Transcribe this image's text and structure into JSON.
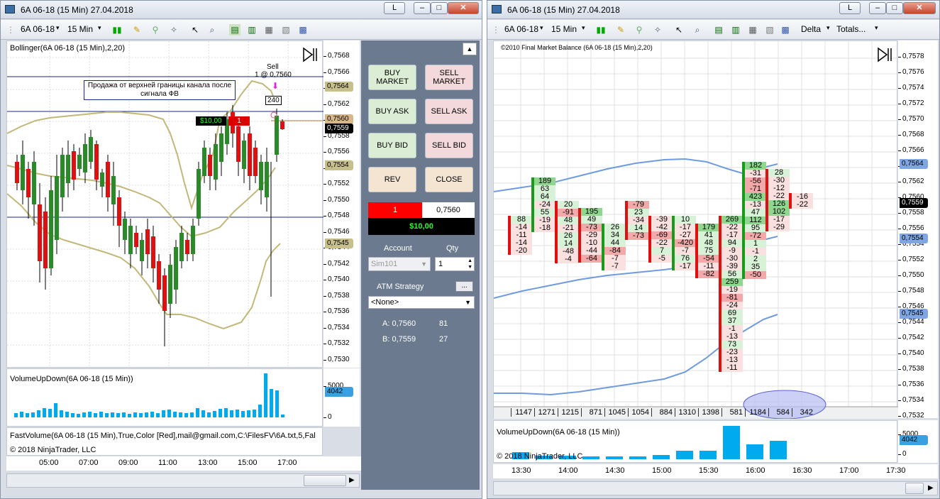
{
  "left_window": {
    "title": "6A 06-18 (15 Min)  27.04.2018",
    "instrument": "6A 06-18",
    "interval": "15 Min",
    "buttons": {
      "restore": "L"
    },
    "price_panel_label": "Bollinger(6A 06-18 (15 Min),2,20)",
    "volume_panel_label": "VolumeUpDown(6A 06-18 (15 Min))",
    "fast_volume_label": "FastVolume(6A 06-18 (15 Min),True,Color [Red],mail@gmail.com,C:\\FilesFV\\6A.txt,5,Fal",
    "copyright": "© 2018 NinjaTrader, LLC",
    "annotation_text": "Продажа от верхней границы канала после сигнала ФВ",
    "sell_label": "Sell",
    "sell_fill": "1 @ 0,7560",
    "marker_value": "240",
    "position_pnl": "$10,00",
    "position_qty": "1",
    "y_ticks": [
      "0,7568",
      "0,7566",
      "0,7564",
      "0,7562",
      "0,7560",
      "0,7558",
      "0,7556",
      "0,7554",
      "0,7552",
      "0,7550",
      "0,7548",
      "0,7546",
      "0,7544",
      "0,7542",
      "0,7540",
      "0,7538",
      "0,7536",
      "0,7534",
      "0,7532",
      "0,7530"
    ],
    "price_tags": [
      {
        "value": "0,7564",
        "color": "#c7bf8c"
      },
      {
        "value": "0,7560",
        "color": "#d8b88a"
      },
      {
        "value": "0,7559",
        "color": "#000000"
      },
      {
        "value": "0,7554",
        "color": "#c7bf8c"
      },
      {
        "value": "0,7545",
        "color": "#c7bf8c"
      }
    ],
    "volume_ticks": [
      "5000",
      "0"
    ],
    "volume_tag": "4042",
    "x_labels": [
      "05:00",
      "07:00",
      "09:00",
      "11:00",
      "13:00",
      "15:00",
      "17:00"
    ]
  },
  "trade_panel": {
    "buy_market": "BUY MARKET",
    "sell_market": "SELL MARKET",
    "buy_ask": "BUY ASK",
    "sell_ask": "SELL ASK",
    "buy_bid": "BUY BID",
    "sell_bid": "SELL BID",
    "rev": "REV",
    "close": "CLOSE",
    "position_qty": "1",
    "position_price": "0,7560",
    "pnl": "$10,00",
    "account_label": "Account",
    "qty_label": "Qty",
    "account_value": "Sim101",
    "qty_value": "1",
    "atm_label": "ATM Strategy",
    "atm_value": "<None>",
    "atm_button": "...",
    "ask_label": "A: 0,7560",
    "ask_size": "81",
    "bid_label": "B: 0,7559",
    "bid_size": "27"
  },
  "right_window": {
    "title": "6A 06-18 (15 Min)  27.04.2018",
    "instrument": "6A 06-18",
    "interval": "15 Min",
    "delta_menu": "Delta",
    "totals_menu": "Totals...",
    "buttons": {
      "restore": "L"
    },
    "price_panel_label": "©2010 Final Market Balance   (6A 06-18 (15 Min),2,20)",
    "volume_panel_label": "VolumeUpDown(6A 06-18 (15 Min))",
    "copyright": "© 2018 NinjaTrader, LLC",
    "y_ticks": [
      "0,7578",
      "0,7576",
      "0,7574",
      "0,7572",
      "0,7570",
      "0,7568",
      "0,7566",
      "0,7564",
      "0,7562",
      "0,7560",
      "0,7558",
      "0,7556",
      "0,7554",
      "0,7552",
      "0,7550",
      "0,7548",
      "0,7546",
      "0,7544",
      "0,7542",
      "0,7540",
      "0,7538",
      "0,7536",
      "0,7534",
      "0,7532"
    ],
    "price_tags": [
      {
        "value": "0,7564",
        "color": "#7fa6e3"
      },
      {
        "value": "0,7559",
        "color": "#000000"
      },
      {
        "value": "0,7554",
        "color": "#7fa6e3"
      },
      {
        "value": "0,7545",
        "color": "#7fa6e3"
      }
    ],
    "volume_ticks": [
      "5000",
      "0"
    ],
    "volume_tag": "4042",
    "totals": [
      "1147",
      "1271",
      "1215",
      "871",
      "1045",
      "1054",
      "884",
      "1310",
      "1398",
      "581",
      "1184",
      "584",
      "342"
    ],
    "x_labels": [
      "13:30",
      "14:00",
      "14:30",
      "15:00",
      "15:30",
      "16:00",
      "16:30",
      "17:00",
      "17:30"
    ],
    "fv_columns": [
      [
        "88",
        "-14",
        "-11",
        "-14",
        "-20"
      ],
      [
        "189",
        "63",
        "64",
        "-24",
        "55",
        "-19",
        "-18"
      ],
      [
        "20",
        "-91",
        "48",
        "-21",
        "26",
        "14",
        "-48",
        "-4"
      ],
      [
        "195",
        "49",
        "-73",
        "-29",
        "-10",
        "-44",
        "-64"
      ],
      [
        "26",
        "34",
        "44",
        "-84",
        "-7",
        "-7"
      ],
      [
        "-79",
        "23",
        "-34",
        "14",
        "-73"
      ],
      [
        "-39",
        "-42",
        "-69",
        "-22",
        "7",
        "-5"
      ],
      [
        "10",
        "-17",
        "-27",
        "-420",
        "-7",
        "76",
        "-17"
      ],
      [
        "179",
        "41",
        "48",
        "75",
        "-54",
        "-11",
        "-82"
      ],
      [
        "269",
        "-22",
        "-17",
        "94",
        "-9",
        "-30",
        "-39",
        "56",
        "259",
        "-19",
        "-81",
        "-24",
        "69",
        "37",
        "-1",
        "-13",
        "73",
        "-23",
        "-13",
        "-11"
      ],
      [
        "182",
        "-31",
        "-56",
        "-71",
        "423",
        "-13",
        "47",
        "112",
        "95",
        "-72",
        "1",
        "-1",
        "2",
        "35",
        "-50"
      ],
      [
        "28",
        "-30",
        "-12",
        "-22",
        "126",
        "102",
        "-17",
        "-29"
      ],
      [
        "-16",
        "-22"
      ]
    ]
  }
}
